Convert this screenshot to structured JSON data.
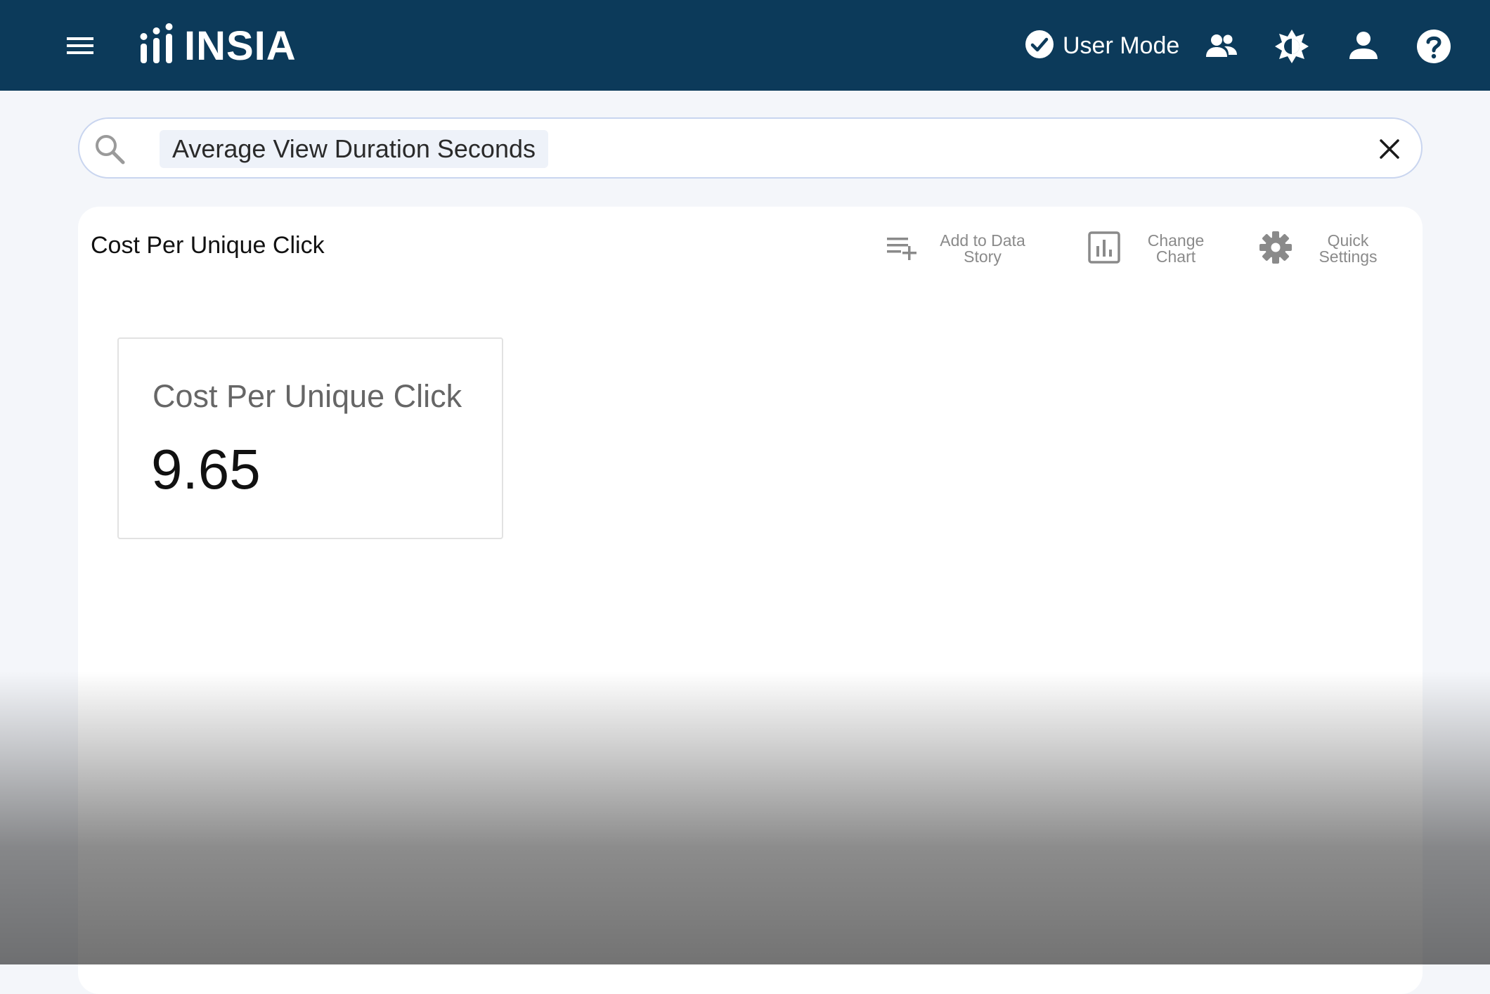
{
  "app": {
    "name": "INSIA",
    "brand_color": "#0c3a5a"
  },
  "header": {
    "menu_icon": "hamburger-menu-icon",
    "logo_icon": "insia-bars-logo-icon",
    "user_mode_label": "User Mode",
    "user_mode_icon": "check-circle-icon",
    "icons": [
      "team-icon",
      "theme-contrast-icon",
      "user-account-icon",
      "help-icon"
    ]
  },
  "search": {
    "query": "Average View Duration Seconds",
    "search_icon": "search-icon",
    "clear_icon": "close-icon"
  },
  "card": {
    "title": "Cost Per Unique Click",
    "actions": [
      {
        "label": "Add to Data Story",
        "icon": "playlist-add-icon"
      },
      {
        "label": "Change Chart",
        "icon": "bar-chart-icon"
      },
      {
        "label": "Quick Settings",
        "icon": "gear-icon"
      }
    ],
    "kpi": {
      "label": "Cost Per Unique Click",
      "value": "9.65"
    }
  }
}
